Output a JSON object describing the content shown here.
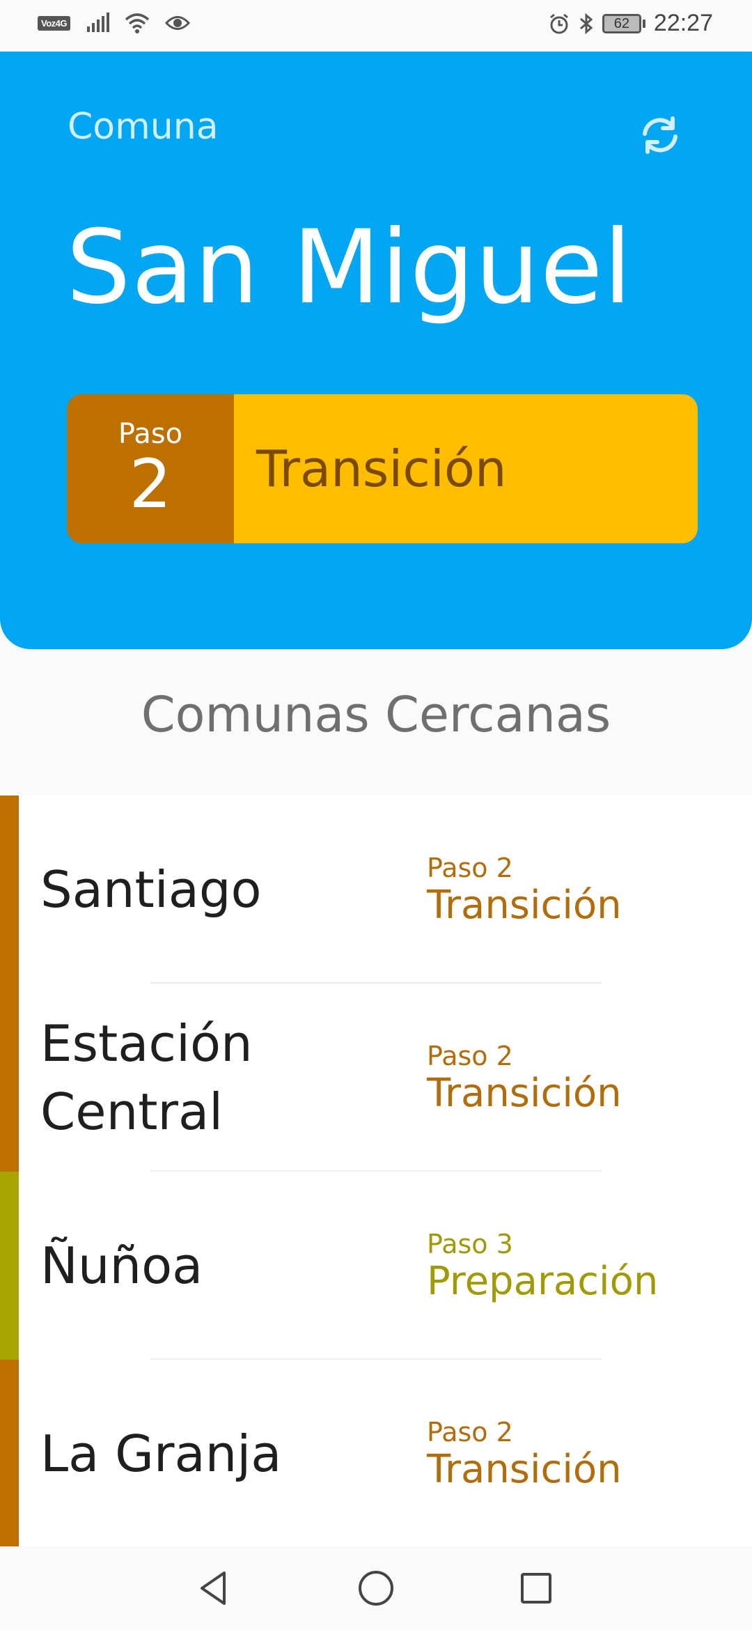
{
  "statusbar": {
    "network": "Voz4G",
    "battery": "62",
    "time": "22:27",
    "icons": [
      "signal-icon",
      "wifi-icon",
      "eye-icon",
      "alarm-icon",
      "bluetooth-icon",
      "battery-icon"
    ]
  },
  "header": {
    "label": "Comuna",
    "name": "San Miguel",
    "phase": {
      "paso_label": "Paso",
      "paso_number": "2",
      "stage": "Transición"
    },
    "colors": {
      "background": "#03a6f2",
      "phase_dark": "#bd7000",
      "phase_light": "#ffbd00"
    }
  },
  "section": {
    "title": "Comunas Cercanas"
  },
  "nearby": [
    {
      "name": "Santiago",
      "paso": "Paso 2",
      "stage": "Transición",
      "color": "#bd7000",
      "text_color": "#b26d0a"
    },
    {
      "name": "Estación Central",
      "paso": "Paso 2",
      "stage": "Transición",
      "color": "#bd7000",
      "text_color": "#b26d0a"
    },
    {
      "name": "Ñuñoa",
      "paso": "Paso 3",
      "stage": "Preparación",
      "color": "#a8a500",
      "text_color": "#a09a07"
    },
    {
      "name": "La Granja",
      "paso": "Paso 2",
      "stage": "Transición",
      "color": "#bd7000",
      "text_color": "#b26d0a"
    }
  ],
  "navbar": {
    "icons": [
      "back-icon",
      "home-icon",
      "recents-icon"
    ]
  }
}
